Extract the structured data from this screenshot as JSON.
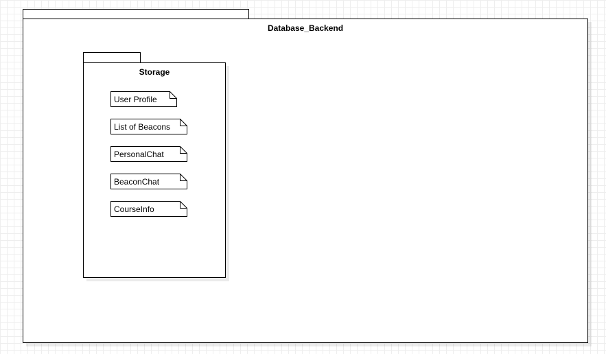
{
  "diagram": {
    "outer_package": {
      "title": "Database_Backend"
    },
    "inner_package": {
      "title": "Storage",
      "notes": [
        {
          "label": "User Profile"
        },
        {
          "label": "List of Beacons"
        },
        {
          "label": "PersonalChat"
        },
        {
          "label": "BeaconChat"
        },
        {
          "label": "CourseInfo"
        }
      ]
    }
  }
}
